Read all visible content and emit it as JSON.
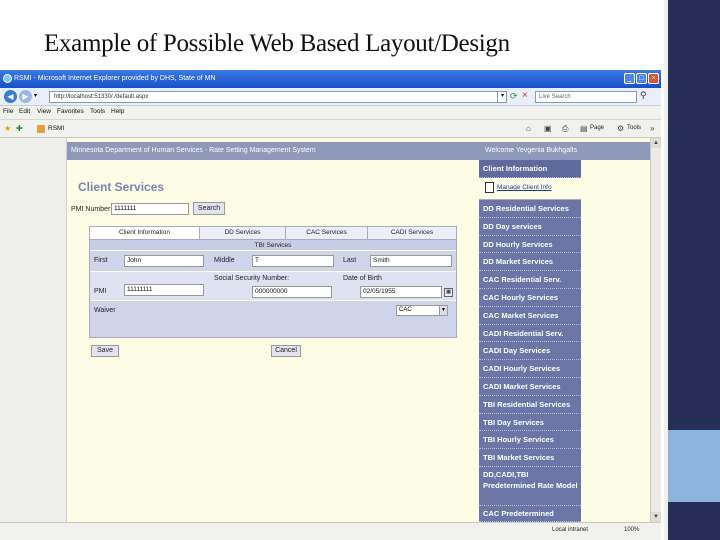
{
  "slide": {
    "title": "Example of Possible Web Based Layout/Design"
  },
  "browser": {
    "window_title": "RSMI - Microsoft Internet Explorer provided by DHS, State of MN",
    "address": "http://localhost:51330/     /default.aspx",
    "search_placeholder": "Live Search",
    "tab_title": "RSMI",
    "menu": [
      "File",
      "Edit",
      "View",
      "Favorites",
      "Tools",
      "Help"
    ],
    "toolbar": {
      "page_label": "Page",
      "tools_label": "Tools"
    },
    "status": {
      "zone": "Local intranet",
      "zoom": "100%"
    }
  },
  "app": {
    "header_title": "Minnesota Department of Human Services - Rate Setting Management System",
    "welcome": "Welcome Yevgenia Bukhgalts",
    "page_heading": "Client Services",
    "cin": {
      "label": "PMI Number:",
      "value": "1111111",
      "search_label": "Search"
    },
    "tabs": [
      "Client Information",
      "DD Services",
      "CAC Services",
      "CADI Services"
    ],
    "sub_tab": "TBI Services",
    "form": {
      "first_label": "First",
      "first_value": "John",
      "middle_label": "Middle",
      "middle_value": "T",
      "last_label": "Last",
      "last_value": "Smith",
      "ssn_label": "Social Security Number:",
      "ssn_value": "000000000",
      "dob_label": "Date of Birth",
      "dob_value": "02/05/1955",
      "pmi_label": "PMI",
      "pmi_value": "11111111",
      "waiver_label": "Waiver",
      "waiver_value": "CAC"
    },
    "actions": {
      "save_label": "Save",
      "cancel_label": "Cancel"
    },
    "right_menu": {
      "client_information": "Client Information",
      "manage_link": "Manage Client Info",
      "items": [
        "DD Residential Services",
        "DD Day services",
        "DD Hourly Services",
        "DD Market Services",
        "CAC Residential Serv.",
        "CAC Hourly Services",
        "CAC Market Services",
        "CADI Residential Serv.",
        "CADI Day Services",
        "CADI Hourly Services",
        "CADI Market Services",
        "TBI Residential Services",
        "TBI Day Services",
        "TBI Hourly Services",
        "TBI Market Services"
      ],
      "predetermined": "DD,CADI,TBI Predetermined Rate Model",
      "cac_predetermined": "CAC Predetermined"
    }
  },
  "colors": {
    "sidebar_dark": "#262e58",
    "sidebar_accent": "#8cb4df",
    "menu_purple": "#6b76a6",
    "form_background": "#fdfde5",
    "link_blue": "#1a3aa8"
  }
}
